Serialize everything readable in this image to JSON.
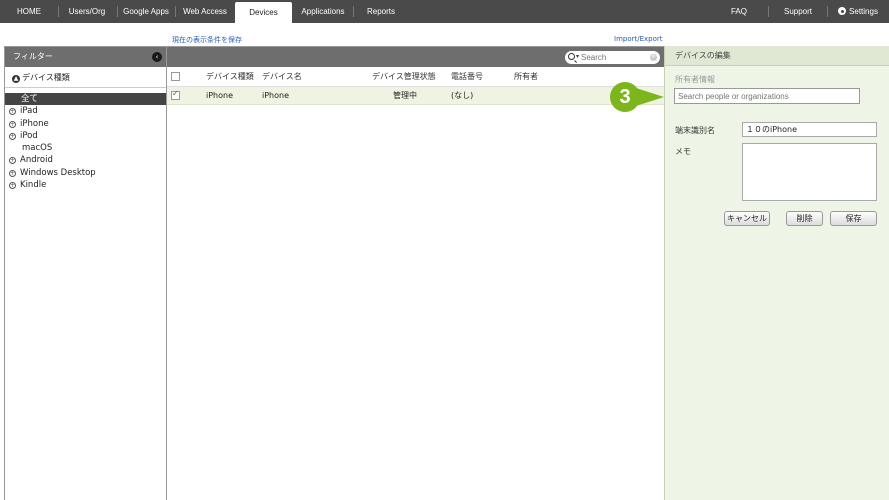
{
  "nav": {
    "left": [
      "HOME",
      "Users/Org",
      "Google Apps",
      "Web Access",
      "Devices",
      "Applications",
      "Reports"
    ],
    "right": [
      "FAQ",
      "Support",
      "Settings"
    ]
  },
  "toolbar": {
    "save_filter": "現在の表示条件を保存",
    "import_export": "Import/Export"
  },
  "filter_panel": {
    "title": "フィルター",
    "group": "デバイス種類",
    "items": [
      "全て",
      "iPad",
      "iPhone",
      "iPod",
      "macOS",
      "Android",
      "Windows Desktop",
      "Kindle"
    ]
  },
  "search": {
    "placeholder": "Search"
  },
  "table": {
    "headers": [
      "デバイス種類",
      "デバイス名",
      "デバイス管理状態",
      "電話番号",
      "所有者"
    ],
    "rows": [
      {
        "type": "iPhone",
        "name": "iPhone",
        "status": "管理中",
        "phone": "(なし)",
        "owner": ""
      }
    ]
  },
  "edit_panel": {
    "title": "デバイスの編集",
    "owner_label": "所有者情報",
    "owner_placeholder": "Search people or organizations",
    "device_name_label": "端末識別名",
    "device_name_value": "１０のiPhone",
    "memo_label": "メモ",
    "cancel": "キャンセル",
    "delete": "削除",
    "save": "保存"
  },
  "annotation": {
    "step": "3"
  },
  "colors": {
    "nav_bg": "#4a4a4a",
    "panel_bg": "#eff5e6",
    "accent": "#7cb51c",
    "link": "#2a5db0"
  }
}
